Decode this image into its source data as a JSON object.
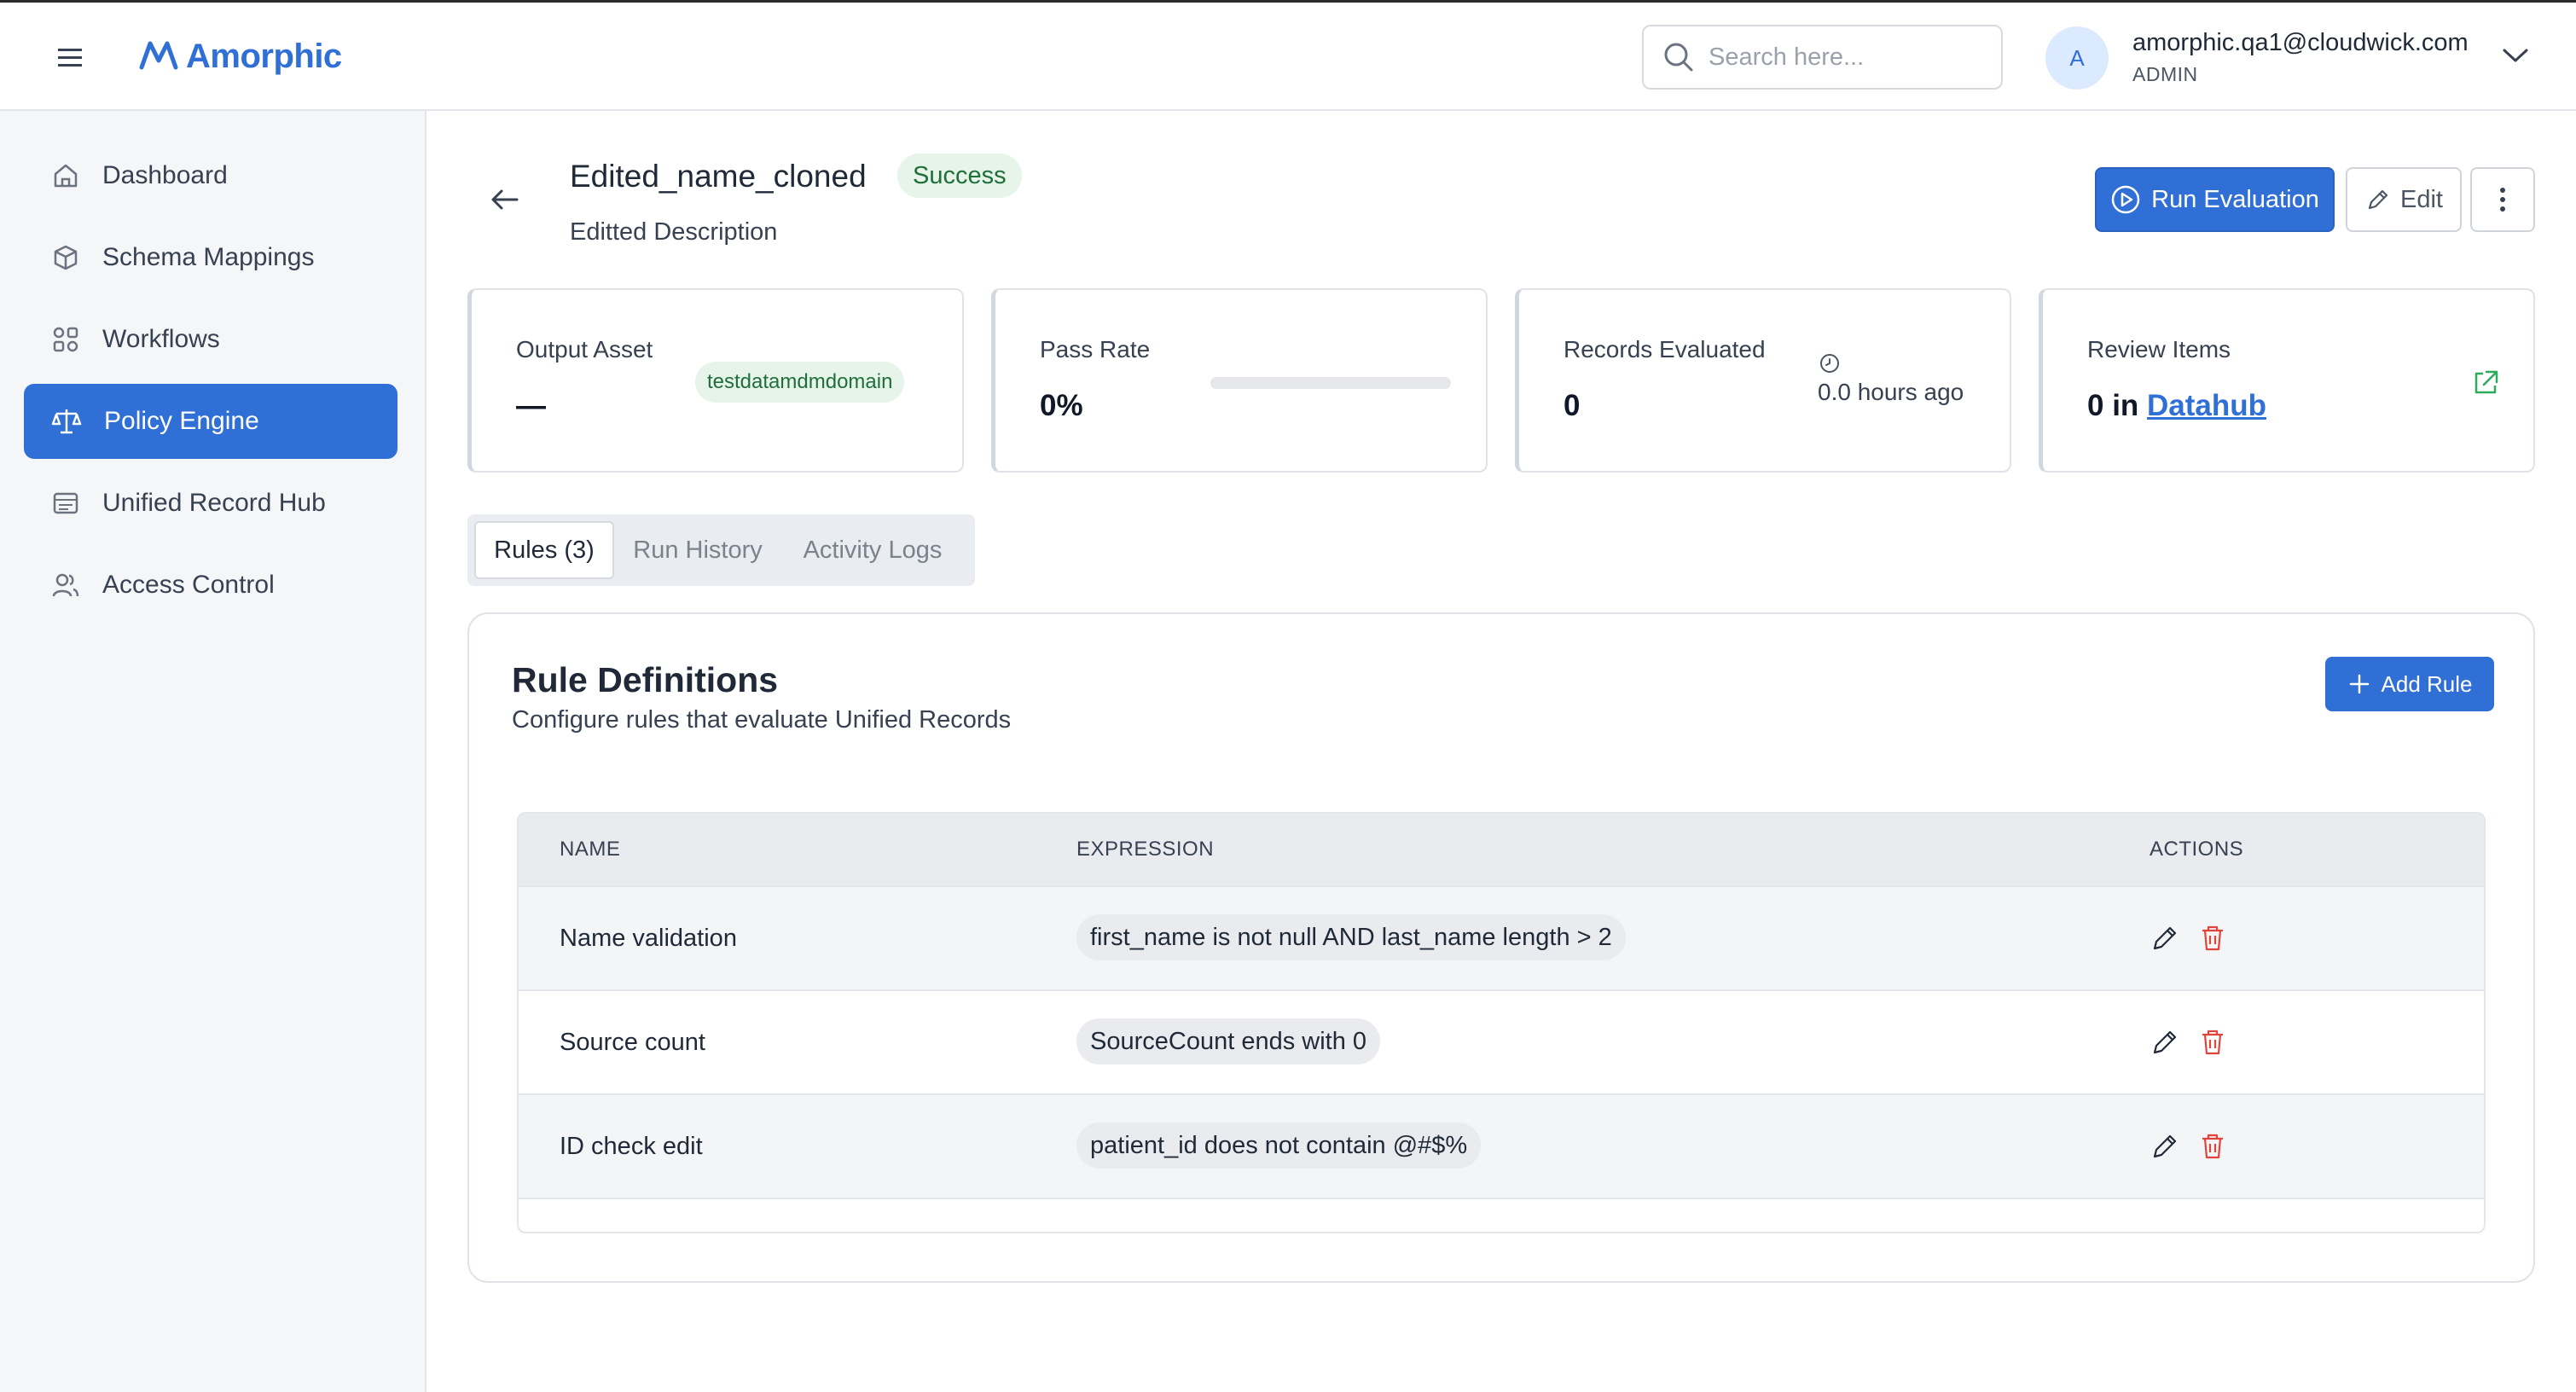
{
  "header": {
    "brand": "Amorphic",
    "search_placeholder": "Search here...",
    "user": {
      "avatar_initial": "A",
      "email": "amorphic.qa1@cloudwick.com",
      "role": "ADMIN"
    }
  },
  "sidebar": {
    "items": [
      {
        "label": "Dashboard",
        "icon": "home-icon",
        "active": false
      },
      {
        "label": "Schema Mappings",
        "icon": "cube-icon",
        "active": false
      },
      {
        "label": "Workflows",
        "icon": "workflow-icon",
        "active": false
      },
      {
        "label": "Policy Engine",
        "icon": "scale-icon",
        "active": true
      },
      {
        "label": "Unified Record Hub",
        "icon": "records-icon",
        "active": false
      },
      {
        "label": "Access Control",
        "icon": "users-icon",
        "active": false
      }
    ]
  },
  "policy": {
    "title": "Edited_name_cloned",
    "status": "Success",
    "description": "Editted Description"
  },
  "actions": {
    "run_label": "Run Evaluation",
    "edit_label": "Edit"
  },
  "stats": {
    "output_asset": {
      "label": "Output Asset",
      "value": "—",
      "domain": "testdatamdmdomain"
    },
    "pass_rate": {
      "label": "Pass Rate",
      "value": "0%",
      "progress_fraction": 0
    },
    "records_evaluated": {
      "label": "Records Evaluated",
      "value": "0",
      "time_ago": "0.0 hours ago"
    },
    "review_items": {
      "label": "Review Items",
      "prefix": "0 in",
      "link": "Datahub"
    }
  },
  "tabs": [
    {
      "label": "Rules (3)",
      "active": true
    },
    {
      "label": "Run History",
      "active": false
    },
    {
      "label": "Activity Logs",
      "active": false
    }
  ],
  "rules_panel": {
    "title": "Rule Definitions",
    "subtitle": "Configure rules that evaluate Unified Records",
    "add_label": "Add Rule",
    "columns": [
      "NAME",
      "EXPRESSION",
      "ACTIONS"
    ],
    "rows": [
      {
        "name": "Name validation",
        "expression": "first_name is not null AND last_name length > 2"
      },
      {
        "name": "Source count",
        "expression": "SourceCount ends with 0"
      },
      {
        "name": "ID check edit",
        "expression": "patient_id does not contain @#$%"
      }
    ]
  },
  "colors": {
    "accent": "#2f6fd6",
    "success_bg": "#e6f4ea",
    "success_text": "#1f6f3a",
    "danger": "#e0443a"
  }
}
